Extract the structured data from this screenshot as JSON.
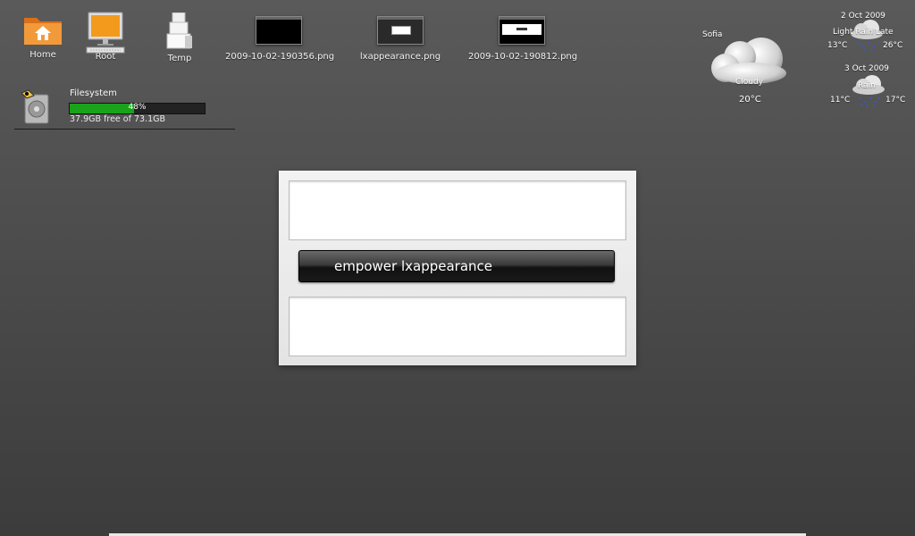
{
  "desktop": {
    "icons": [
      {
        "label": "Home"
      },
      {
        "label": "Root"
      },
      {
        "label": "Temp"
      },
      {
        "label": "2009-10-02-190356.png"
      },
      {
        "label": "lxappearance.png"
      },
      {
        "label": "2009-10-02-190812.png"
      }
    ]
  },
  "filesystem": {
    "title": "Filesystem",
    "percent_label": "48%",
    "percent": 48,
    "free_text": "37.9GB free of 73.1GB"
  },
  "weather": {
    "city": "Sofia",
    "condition": "Cloudy",
    "temperature": "20°C",
    "forecast": [
      {
        "date": "2 Oct 2009",
        "condition": "Light Rain Late",
        "low": "13°C",
        "high": "26°C"
      },
      {
        "date": "3 Oct 2009",
        "condition": "Rain",
        "low": "11°C",
        "high": "17°C"
      }
    ]
  },
  "dialog": {
    "button_label": "empower lxappearance"
  },
  "colors": {
    "progress_fill": "#1aa31a",
    "folder_orange": "#f08a24"
  }
}
